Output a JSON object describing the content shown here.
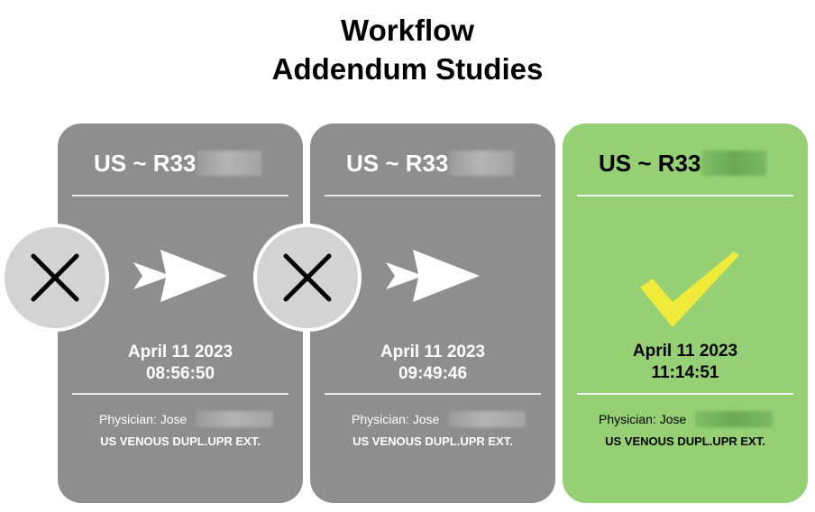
{
  "title": {
    "line1": "Workflow",
    "line2": "Addendum Studies"
  },
  "cards": [
    {
      "study_id": "US ~ R33",
      "date": "April 11 2023",
      "time": "08:56:50",
      "physician": "Physician: Jose",
      "exam": "US VENOUS DUPL.UPR EXT.",
      "status": "failed",
      "icon": "arrow-right-icon"
    },
    {
      "study_id": "US ~ R33",
      "date": "April 11 2023",
      "time": "09:49:46",
      "physician": "Physician: Jose",
      "exam": "US VENOUS DUPL.UPR EXT.",
      "status": "failed",
      "icon": "arrow-right-icon"
    },
    {
      "study_id": "US ~ R33",
      "date": "April 11 2023",
      "time": "11:14:51",
      "physician": "Physician: Jose",
      "exam": "US VENOUS DUPL.UPR EXT.",
      "status": "success",
      "icon": "checkmark-icon"
    }
  ],
  "markers": [
    "x-icon",
    "x-icon"
  ],
  "colors": {
    "card_default": "#8e8e8e",
    "card_success": "#95d075",
    "checkmark": "#f0ea3a",
    "marker_fill": "#d3d3d3",
    "x_stroke": "#000000"
  }
}
